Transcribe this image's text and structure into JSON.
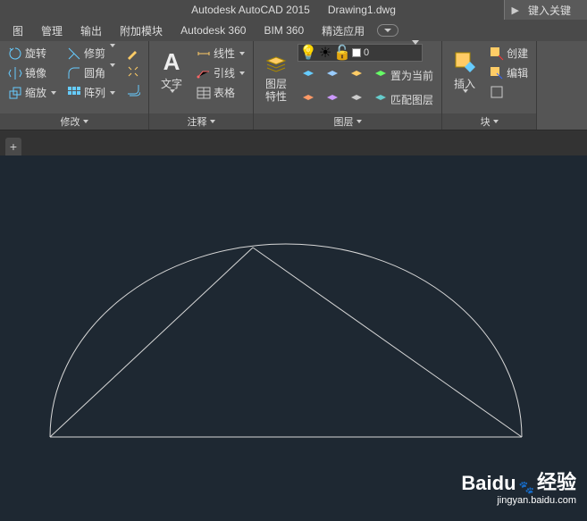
{
  "title": {
    "app": "Autodesk AutoCAD 2015",
    "doc": "Drawing1.dwg",
    "search_hint": "键入关键"
  },
  "menu": {
    "view": "图",
    "manage": "管理",
    "output": "输出",
    "addon": "附加模块",
    "a360": "Autodesk 360",
    "bim360": "BIM 360",
    "featured": "精选应用"
  },
  "modify": {
    "title": "修改",
    "rotate": "旋转",
    "trim": "修剪",
    "mirror": "镜像",
    "fillet": "圆角",
    "scale": "缩放",
    "array": "阵列"
  },
  "annotate": {
    "title": "注释",
    "text": "文字",
    "linear": "线性",
    "leader": "引线",
    "table": "表格"
  },
  "layers": {
    "title": "图层",
    "props": "图层\n特性",
    "current": "0",
    "make_current": "置为当前",
    "match": "匹配图层"
  },
  "block": {
    "title": "块",
    "insert": "插入",
    "create": "创建",
    "edit": "编辑"
  },
  "filetab": {
    "new": "+"
  },
  "watermark": {
    "brand": "Baidu",
    "sub": "经验",
    "url": "jingyan.baidu.com"
  }
}
